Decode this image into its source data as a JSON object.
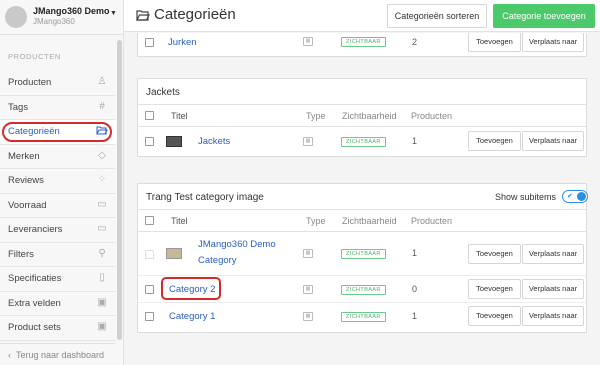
{
  "brand": {
    "name": "JMango360 Demo",
    "sub": "JMango360"
  },
  "sidebar": {
    "section": "PRODUCTEN",
    "items": [
      {
        "label": "Producten",
        "icon": "shirt-icon",
        "glyph": "♙"
      },
      {
        "label": "Tags",
        "icon": "hash-icon",
        "glyph": "#"
      },
      {
        "label": "Categorieën",
        "icon": "folder-open-icon",
        "glyph": "▭"
      },
      {
        "label": "Merken",
        "icon": "tag-icon",
        "glyph": "◇"
      },
      {
        "label": "Reviews",
        "icon": "grid-dots-icon",
        "glyph": "⁘"
      },
      {
        "label": "Voorraad",
        "icon": "box-icon",
        "glyph": "▭"
      },
      {
        "label": "Leveranciers",
        "icon": "truck-icon",
        "glyph": "▭"
      },
      {
        "label": "Filters",
        "icon": "funnel-icon",
        "glyph": "⚲"
      },
      {
        "label": "Specificaties",
        "icon": "chart-icon",
        "glyph": "▯"
      },
      {
        "label": "Extra velden",
        "icon": "card-icon",
        "glyph": "▣"
      },
      {
        "label": "Product sets",
        "icon": "set-icon",
        "glyph": "▣"
      }
    ],
    "back": "Terug naar dashboard"
  },
  "header": {
    "title": "Categorieën",
    "sort_label": "Categorieën sorteren",
    "add_label": "Categorie toevoegen"
  },
  "columns": {
    "title": "Titel",
    "type": "Type",
    "visibility": "Zichtbaarheid",
    "products": "Producten"
  },
  "actions": {
    "add": "Toevoegen",
    "move": "Verplaats naar"
  },
  "top_row": {
    "title": "Jurken",
    "visibility": "ZICHTBAAR",
    "products": "2"
  },
  "panels": [
    {
      "title": "Jackets",
      "rows": [
        {
          "title": "Jackets",
          "visibility": "ZICHTBAAR",
          "products": "1"
        }
      ]
    },
    {
      "title": "Trang Test category image",
      "toggle_label": "Show subitems",
      "rows": [
        {
          "title": "JMango360 Demo Category",
          "visibility": "ZICHTBAAR",
          "products": "1"
        },
        {
          "title": "Category 2",
          "visibility": "ZICHTBAAR",
          "products": "0"
        },
        {
          "title": "Category 1",
          "visibility": "ZICHTBAAR",
          "products": "1"
        }
      ]
    }
  ],
  "colors": {
    "accent": "#2a5dc4",
    "primary_button": "#4cc96a",
    "highlight": "#d62a2a",
    "visible_badge": "#48b06b"
  }
}
